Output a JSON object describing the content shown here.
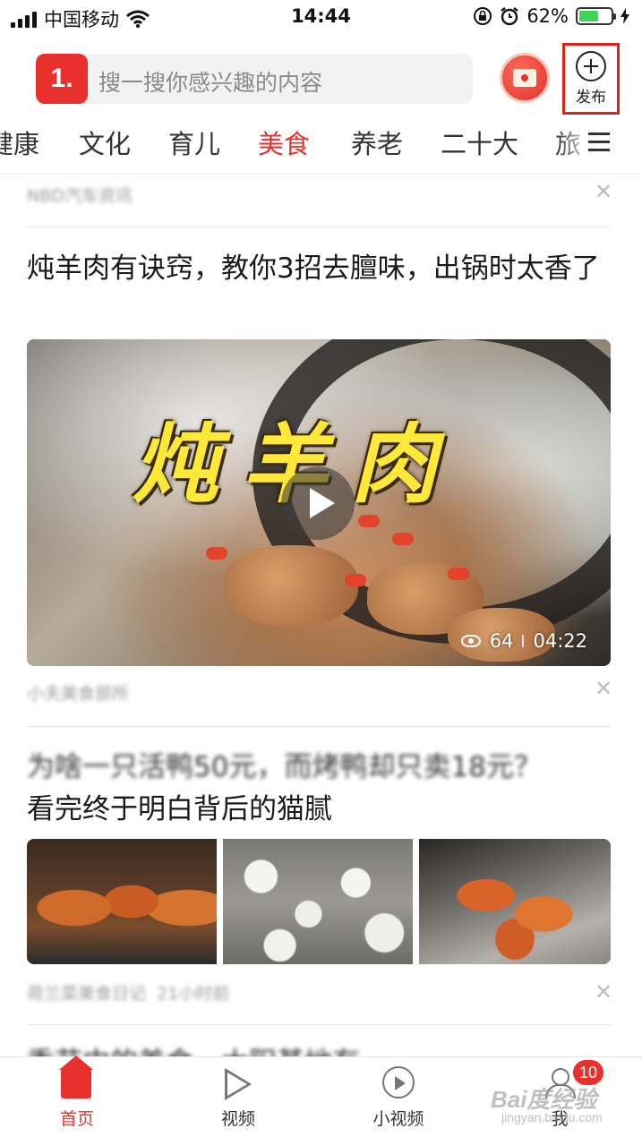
{
  "status_bar": {
    "carrier": "中国移动",
    "time": "14:44",
    "battery": "62%",
    "battery_level": 0.62
  },
  "header": {
    "logo": "1.",
    "search_placeholder": "搜一搜你感兴趣的内容",
    "publish_label": "发布"
  },
  "tabs": {
    "items": [
      "健康",
      "文化",
      "育儿",
      "美食",
      "养老",
      "二十大",
      "旅"
    ],
    "active": "美食"
  },
  "feed": {
    "prev_source": "NBD汽车资讯",
    "article1": {
      "title": "炖羊肉有诀窍，教你3招去膻味，出锅时太香了",
      "video_overlay": "炖羊肉",
      "views": "64",
      "duration": "04:22",
      "source": "小夫美食部所"
    },
    "article2": {
      "title_line1": "为啥一只活鸭50元，而烤鸭却只卖18元？",
      "title_line2": "看完终于明白背后的猫腻",
      "source": "荷兰菜美食日记",
      "time": "21小时前"
    },
    "article3": {
      "title_partial": "季节中的美食，太阳基地有"
    }
  },
  "tabbar": {
    "home": "首页",
    "video": "视频",
    "short_video": "小视频",
    "me": "我",
    "badge": "10"
  },
  "watermark": {
    "main": "Bai度经验",
    "sub": "jingyan.baidu.com"
  }
}
